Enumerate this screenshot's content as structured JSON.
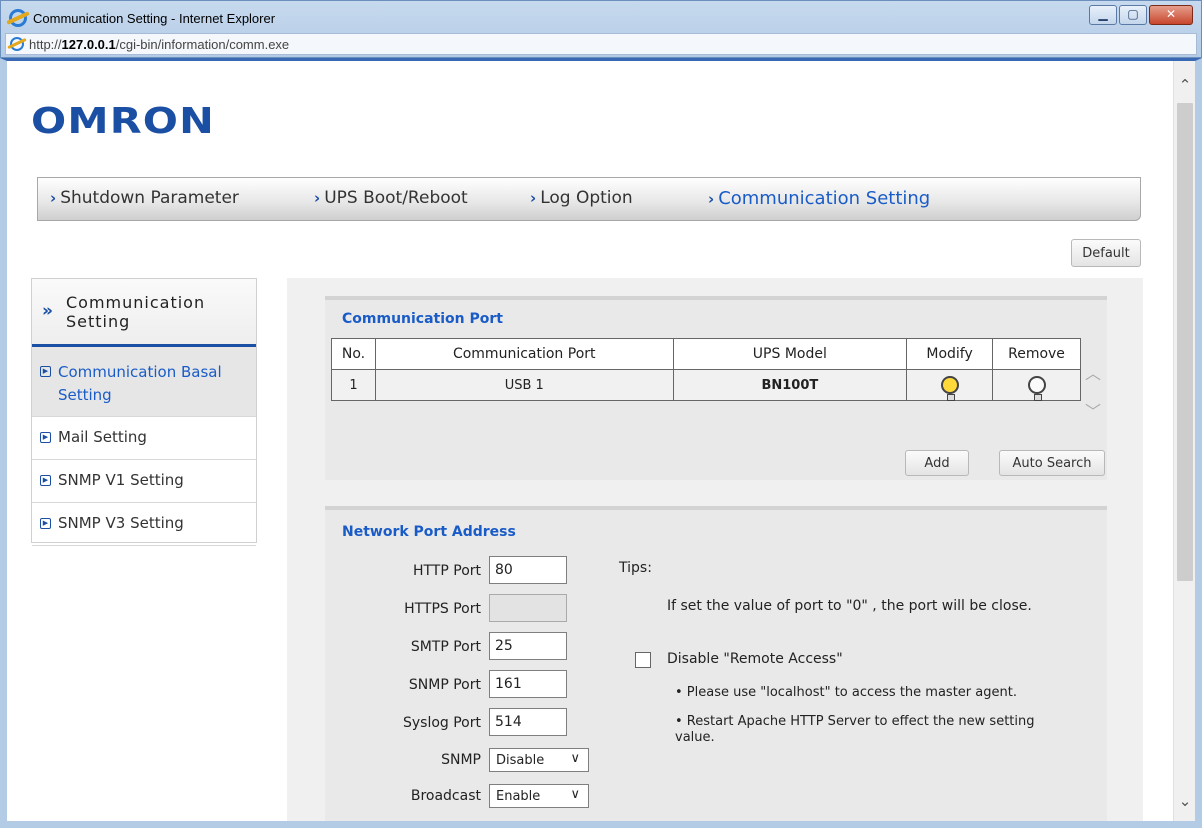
{
  "window": {
    "title": "Communication Setting - Internet Explorer",
    "url_prefix": "http://",
    "url_host": "127.0.0.1",
    "url_path": "/cgi-bin/information/comm.exe",
    "minimize_glyph": "▁",
    "maximize_glyph": "▢",
    "close_glyph": "✕"
  },
  "brand": {
    "logo": "OMRON"
  },
  "nav": {
    "items": [
      {
        "label": "Shutdown Parameter"
      },
      {
        "label": "UPS Boot/Reboot"
      },
      {
        "label": "Log Option"
      },
      {
        "label": "Communication Setting"
      }
    ],
    "arrow": "›"
  },
  "default_button": "Default",
  "sidebar": {
    "arrows": "»",
    "title": "Communication Setting",
    "items": [
      {
        "label": "Communication Basal Setting"
      },
      {
        "label": "Mail Setting"
      },
      {
        "label": "SNMP V1 Setting"
      },
      {
        "label": "SNMP V3 Setting"
      }
    ],
    "bullet": "▶"
  },
  "comm_port": {
    "title": "Communication Port",
    "headers": [
      "No.",
      "Communication Port",
      "UPS Model",
      "Modify",
      "Remove"
    ],
    "rows": [
      {
        "no": "1",
        "port": "USB 1",
        "model": "BN100T"
      }
    ],
    "add_button": "Add",
    "auto_search_button": "Auto Search",
    "scroll_up": "︿",
    "scroll_down": "﹀"
  },
  "network": {
    "title": "Network Port Address",
    "http_label": "HTTP Port",
    "http_value": "80",
    "https_label": "HTTPS Port",
    "https_value": "",
    "smtp_label": "SMTP Port",
    "smtp_value": "25",
    "snmp_port_label": "SNMP Port",
    "snmp_port_value": "161",
    "syslog_label": "Syslog Port",
    "syslog_value": "514",
    "snmp_label": "SNMP",
    "snmp_value": "Disable",
    "broadcast_label": "Broadcast",
    "broadcast_value": "Enable",
    "tips_label": "Tips:",
    "tip_text": "If set the value of port to \"0\" , the port will be close.",
    "remote_access_label": "Disable \"Remote Access\"",
    "note_1": "• Please use \"localhost\" to access the master agent.",
    "note_2": "• Restart Apache HTTP Server to effect the new setting value."
  },
  "scrollbar": {
    "up": "⌃",
    "down": "⌄"
  }
}
